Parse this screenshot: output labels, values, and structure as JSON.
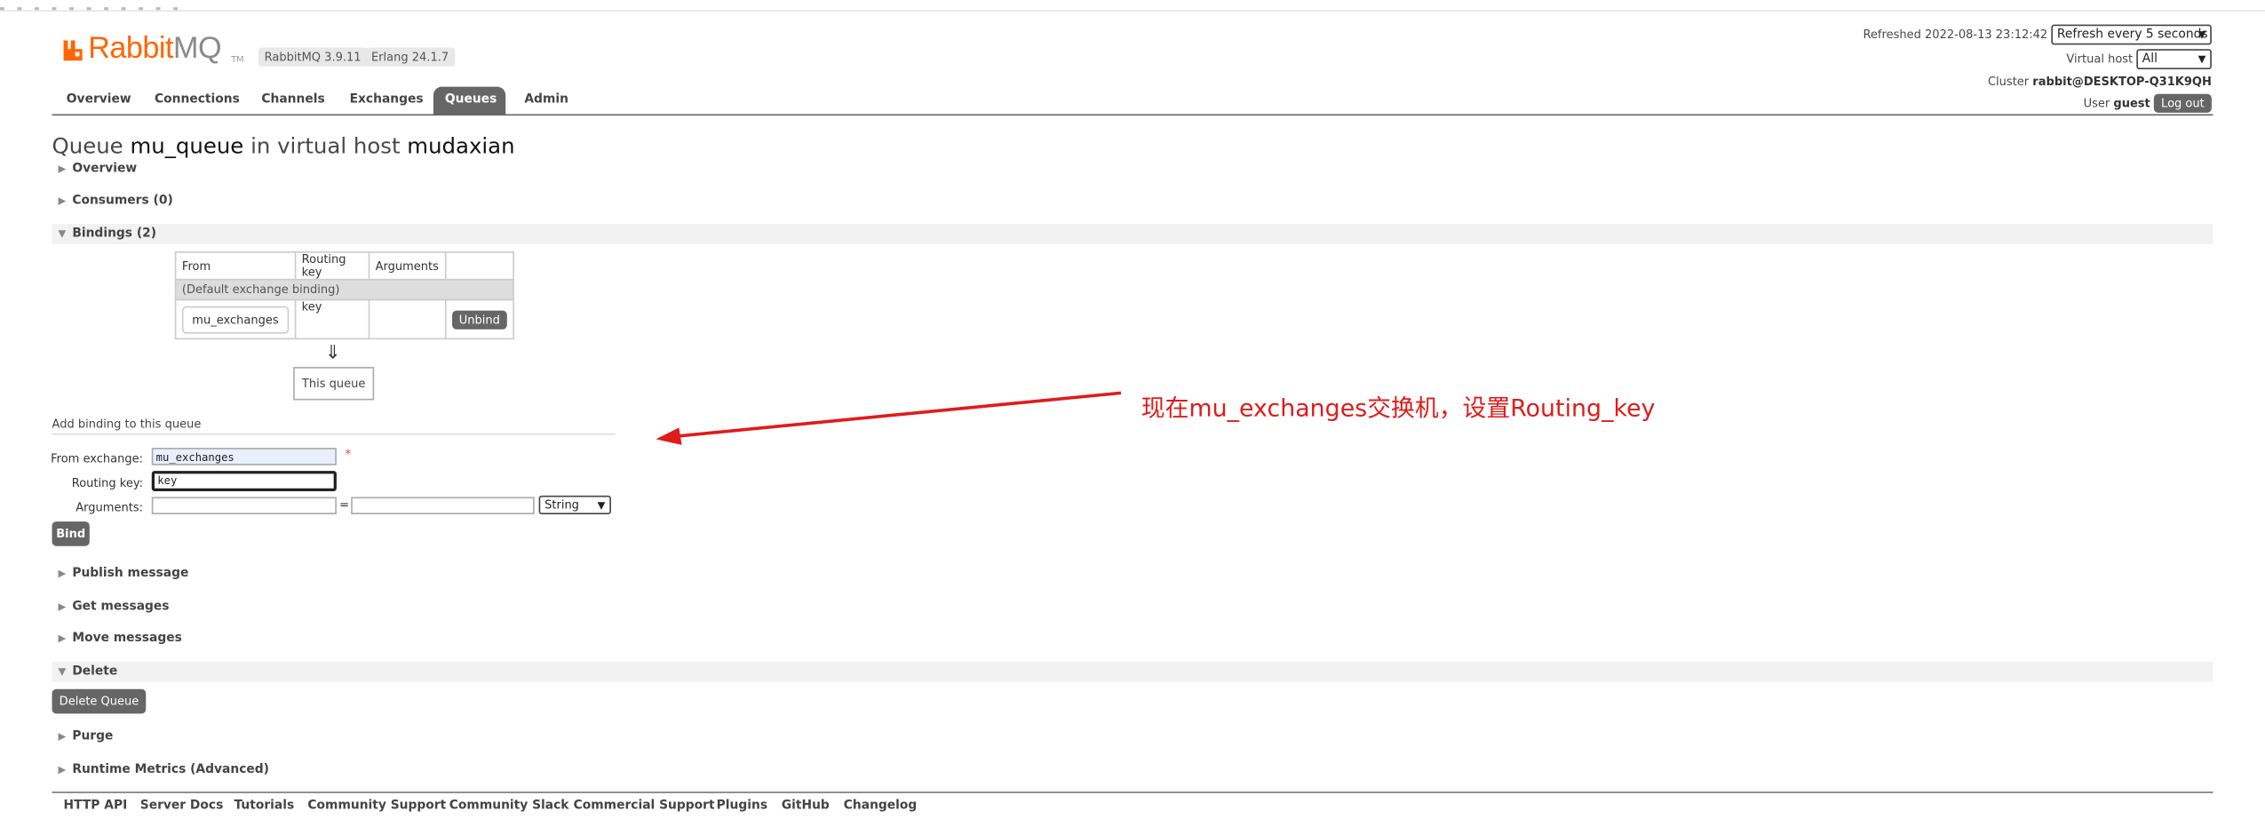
{
  "header": {
    "logo_main": "Rabbit",
    "logo_mq": "MQ",
    "logo_tm": "TM",
    "rabbitmq_version": "RabbitMQ 3.9.11",
    "erlang_version": "Erlang 24.1.7",
    "refreshed_label": "Refreshed",
    "refreshed_time": "2022-08-13 23:12:42",
    "refresh_select": "Refresh every 5 seconds",
    "virtual_host_label": "Virtual host",
    "virtual_host_value": "All",
    "cluster_label": "Cluster",
    "cluster_value": "rabbit@DESKTOP-Q31K9QH",
    "user_label": "User",
    "user_value": "guest",
    "logout": "Log out"
  },
  "nav": {
    "tabs": [
      "Overview",
      "Connections",
      "Channels",
      "Exchanges",
      "Queues",
      "Admin"
    ],
    "active": "Queues"
  },
  "page_title": {
    "prefix": "Queue",
    "queue_name": "mu_queue",
    "mid": "in virtual host",
    "vhost": "mudaxian"
  },
  "sections": {
    "overview": "Overview",
    "consumers": "Consumers (0)",
    "bindings": "Bindings (2)",
    "publish": "Publish message",
    "get": "Get messages",
    "move": "Move messages",
    "delete": "Delete",
    "purge": "Purge",
    "runtime": "Runtime Metrics (Advanced)"
  },
  "bindings_table": {
    "headers": [
      "From",
      "Routing key",
      "Arguments",
      ""
    ],
    "default_binding": "(Default exchange binding)",
    "row": {
      "from": "mu_exchanges",
      "routing_key": "key",
      "arguments": "",
      "action": "Unbind"
    },
    "arrow": "⇓",
    "this_queue": "This queue"
  },
  "add_binding": {
    "heading": "Add binding to this queue",
    "from_label": "From exchange:",
    "from_value": "mu_exchanges",
    "required_mark": "*",
    "routing_label": "Routing key:",
    "routing_value": "key",
    "args_label": "Arguments:",
    "args_eq": "=",
    "args_type": "String",
    "bind_button": "Bind"
  },
  "delete_button": "Delete Queue",
  "footer": [
    "HTTP API",
    "Server Docs",
    "Tutorials",
    "Community Support",
    "Community Slack",
    "Commercial Support",
    "Plugins",
    "GitHub",
    "Changelog"
  ],
  "annotation": "现在mu_exchanges交换机，设置Routing_key",
  "colors": {
    "brand": "#ff6600",
    "annotation": "#e01b1b",
    "tab_active": "#666666"
  }
}
